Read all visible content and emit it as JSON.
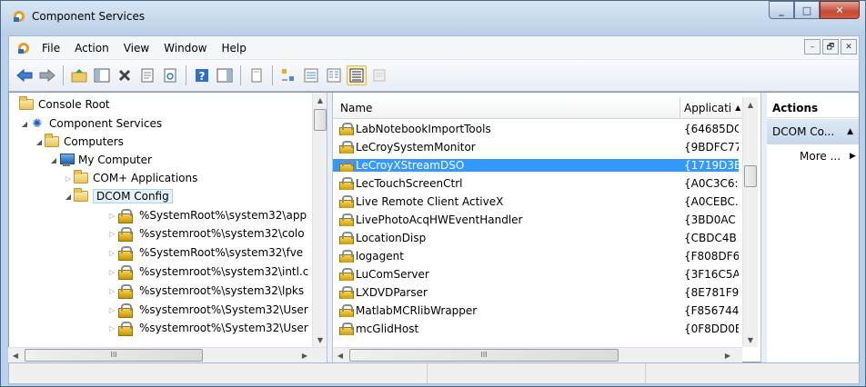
{
  "window": {
    "title": "Component Services",
    "minimize": "_",
    "maximize": "□",
    "close": "✕"
  },
  "menu": {
    "items": [
      "File",
      "Action",
      "View",
      "Window",
      "Help"
    ],
    "mdi": {
      "minimize": "–",
      "restore": "🗗",
      "close": "✕"
    }
  },
  "toolbar": {
    "icons": [
      "back-arrow-icon",
      "forward-arrow-icon",
      "up-folder-icon",
      "show-hide-tree-icon",
      "delete-icon",
      "properties-icon",
      "refresh-icon",
      "help-icon",
      "show-hide-action-pane-icon",
      "export-list-icon",
      "large-icons-view-icon",
      "small-icons-view-icon",
      "list-view-icon",
      "detail-view-icon",
      "configure-icon"
    ]
  },
  "tree": {
    "items": [
      {
        "label": "Console Root",
        "level": 0,
        "icon": "folder",
        "arrow": ""
      },
      {
        "label": "Component Services",
        "level": 1,
        "icon": "component-services",
        "arrow": "◢"
      },
      {
        "label": "Computers",
        "level": 2,
        "icon": "folder",
        "arrow": "◢"
      },
      {
        "label": "My Computer",
        "level": 3,
        "icon": "computer",
        "arrow": "◢"
      },
      {
        "label": "COM+ Applications",
        "level": 4,
        "icon": "folder",
        "arrow": "▷"
      },
      {
        "label": "DCOM Config",
        "level": 4,
        "icon": "folder",
        "arrow": "◢",
        "selected": true
      },
      {
        "label": "%SystemRoot%\\system32\\app",
        "level": 5,
        "icon": "package",
        "arrow": "▷"
      },
      {
        "label": "%systemroot%\\system32\\colo",
        "level": 5,
        "icon": "package",
        "arrow": "▷"
      },
      {
        "label": "%SystemRoot%\\system32\\fve",
        "level": 5,
        "icon": "package",
        "arrow": "▷"
      },
      {
        "label": "%systemroot%\\system32\\intl.c",
        "level": 5,
        "icon": "package",
        "arrow": "▷"
      },
      {
        "label": "%systemroot%\\system32\\lpks",
        "level": 5,
        "icon": "package",
        "arrow": "▷"
      },
      {
        "label": "%systemroot%\\System32\\User",
        "level": 5,
        "icon": "package",
        "arrow": "▷"
      },
      {
        "label": "%systemroot%\\System32\\User",
        "level": 5,
        "icon": "package",
        "arrow": "▷"
      }
    ],
    "hscroll_label": "III"
  },
  "list": {
    "columns": {
      "name": "Name",
      "app": "Applicati"
    },
    "rows": [
      {
        "name": "LabNotebookImportTools",
        "app": "{64685DC"
      },
      {
        "name": "LeCroySystemMonitor",
        "app": "{9BDFC77"
      },
      {
        "name": "LeCroyXStreamDSO",
        "app": "{1719D3E",
        "selected": true
      },
      {
        "name": "LecTouchScreenCtrl",
        "app": "{A0C3C6:"
      },
      {
        "name": "Live Remote Client ActiveX",
        "app": "{A0CEBC."
      },
      {
        "name": "LivePhotoAcqHWEventHandler",
        "app": "{3BD0AC"
      },
      {
        "name": "LocationDisp",
        "app": "{CBDC4B"
      },
      {
        "name": "logagent",
        "app": "{F808DF6"
      },
      {
        "name": "LuComServer",
        "app": "{3F16C5A"
      },
      {
        "name": "LXDVDParser",
        "app": "{8E781F9."
      },
      {
        "name": "MatlabMCRlibWrapper",
        "app": "{F856744!"
      },
      {
        "name": "mcGlidHost",
        "app": "{0F8DD0E"
      }
    ],
    "hscroll_label": "III"
  },
  "actions": {
    "header": "Actions",
    "section": "DCOM Co...",
    "item": "More ..."
  }
}
